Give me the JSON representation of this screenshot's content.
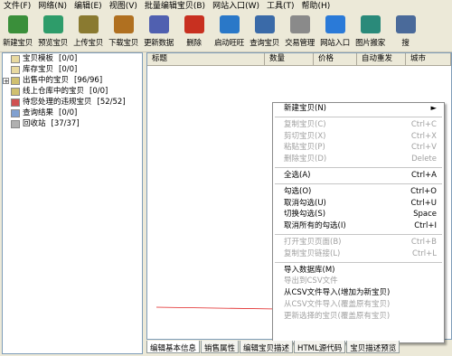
{
  "menubar": [
    "文件(F)",
    "网络(N)",
    "编辑(E)",
    "视图(V)",
    "批量编辑宝贝(B)",
    "网站入口(W)",
    "工具(T)",
    "帮助(H)"
  ],
  "toolbar": [
    {
      "label": "新建宝贝",
      "icon": "new-item-icon",
      "color": "#3a8f3a"
    },
    {
      "label": "预览宝贝",
      "icon": "preview-icon",
      "color": "#2e9c6a"
    },
    {
      "label": "上传宝贝",
      "icon": "upload-icon",
      "color": "#8a7a30"
    },
    {
      "label": "下载宝贝",
      "icon": "download-icon",
      "color": "#b07020"
    },
    {
      "label": "更新数据",
      "icon": "update-data-icon",
      "color": "#5060b0"
    },
    {
      "label": "删除",
      "icon": "delete-icon",
      "color": "#c83020"
    },
    {
      "label": "启动旺旺",
      "icon": "wangwang-icon",
      "color": "#2a78c8"
    },
    {
      "label": "查询宝贝",
      "icon": "search-item-icon",
      "color": "#3a6aa8"
    },
    {
      "label": "交易管理",
      "icon": "trade-manage-icon",
      "color": "#8a8a8a"
    },
    {
      "label": "网站入口",
      "icon": "website-icon",
      "color": "#2a7ad8"
    },
    {
      "label": "图片搬家",
      "icon": "image-move-icon",
      "color": "#2a8a7a"
    },
    {
      "label": "搜",
      "icon": "search-icon",
      "color": "#4a6a9a"
    }
  ],
  "tree": [
    {
      "label": "宝贝模板",
      "count": "[0/0]",
      "expander": false,
      "color": "#e8d9a0"
    },
    {
      "label": "库存宝贝",
      "count": "[0/0]",
      "expander": false,
      "color": "#e8d9a0"
    },
    {
      "label": "出售中的宝贝",
      "count": "[96/96]",
      "expander": true,
      "color": "#d0c070"
    },
    {
      "label": "线上仓库中的宝贝",
      "count": "[0/0]",
      "expander": false,
      "color": "#d0c070"
    },
    {
      "label": "待您处理的违规宝贝",
      "count": "[52/52]",
      "expander": false,
      "color": "#d05050"
    },
    {
      "label": "查询结果",
      "count": "[0/0]",
      "expander": false,
      "color": "#80a0d0"
    },
    {
      "label": "回收站",
      "count": "[37/37]",
      "expander": false,
      "color": "#b0b0b0"
    }
  ],
  "grid_columns": [
    "标题",
    "数量",
    "价格",
    "自动重发",
    "城市"
  ],
  "context_menu": [
    {
      "label": "新建宝贝(N)",
      "shortcut": "►",
      "disabled": false
    },
    {
      "sep": true
    },
    {
      "label": "复制宝贝(C)",
      "shortcut": "Ctrl+C",
      "disabled": true
    },
    {
      "label": "剪切宝贝(X)",
      "shortcut": "Ctrl+X",
      "disabled": true
    },
    {
      "label": "粘贴宝贝(P)",
      "shortcut": "Ctrl+V",
      "disabled": true
    },
    {
      "label": "删除宝贝(D)",
      "shortcut": "Delete",
      "disabled": true
    },
    {
      "sep": true
    },
    {
      "label": "全选(A)",
      "shortcut": "Ctrl+A",
      "disabled": false
    },
    {
      "sep": true
    },
    {
      "label": "勾选(O)",
      "shortcut": "Ctrl+O",
      "disabled": false
    },
    {
      "label": "取消勾选(U)",
      "shortcut": "Ctrl+U",
      "disabled": false
    },
    {
      "label": "切换勾选(S)",
      "shortcut": "Space",
      "disabled": false
    },
    {
      "label": "取消所有的勾选(I)",
      "shortcut": "Ctrl+I",
      "disabled": false
    },
    {
      "sep": true
    },
    {
      "label": "打开宝贝页面(B)",
      "shortcut": "Ctrl+B",
      "disabled": true
    },
    {
      "label": "复制宝贝链接(L)",
      "shortcut": "Ctrl+L",
      "disabled": true
    },
    {
      "sep": true
    },
    {
      "label": "导入数据库(M)",
      "shortcut": "",
      "disabled": false
    },
    {
      "label": "导出到CSV文件",
      "shortcut": "",
      "disabled": true
    },
    {
      "label": "从CSV文件导入(增加为新宝贝)",
      "shortcut": "",
      "disabled": false
    },
    {
      "label": "从CSV文件导入(覆盖原有宝贝)",
      "shortcut": "",
      "disabled": true
    },
    {
      "label": "更新选择的宝贝(覆盖原有宝贝)",
      "shortcut": "",
      "disabled": true
    }
  ],
  "tabs": [
    "编辑基本信息",
    "销售属性",
    "编辑宝贝描述",
    "HTML源代码",
    "宝贝描述预览"
  ],
  "colors": {
    "arrow": "#e02020",
    "grid_border": "#7f9db9"
  }
}
